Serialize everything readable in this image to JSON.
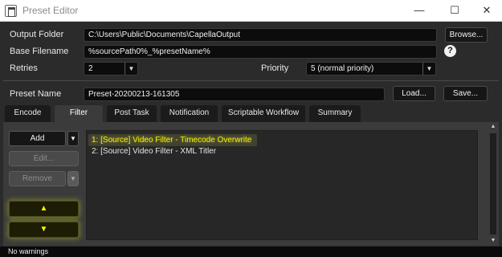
{
  "window": {
    "title": "Preset Editor",
    "minimize_glyph": "—",
    "maximize_glyph": "☐",
    "close_glyph": "✕"
  },
  "form": {
    "output_folder_label": "Output Folder",
    "output_folder_value": "C:\\Users\\Public\\Documents\\CapellaOutput",
    "browse_label": "Browse...",
    "base_filename_label": "Base Filename",
    "base_filename_value": "%sourcePath0%_%presetName%",
    "help_glyph": "?",
    "retries_label": "Retries",
    "retries_value": "2",
    "priority_label": "Priority",
    "priority_value": "5 (normal priority)",
    "preset_name_label": "Preset Name",
    "preset_name_value": "Preset-20200213-161305",
    "load_label": "Load...",
    "save_label": "Save..."
  },
  "tabs": [
    {
      "label": "Encode"
    },
    {
      "label": "Filter",
      "active": true
    },
    {
      "label": "Post Task"
    },
    {
      "label": "Notification"
    },
    {
      "label": "Scriptable Workflow"
    },
    {
      "label": "Summary"
    }
  ],
  "filter_panel": {
    "add_label": "Add",
    "edit_label": "Edit...",
    "remove_label": "Remove",
    "dropdown_glyph": "▼",
    "move_up_glyph": "▲",
    "move_down_glyph": "▼",
    "items": [
      {
        "text": "1: [Source] Video Filter - Timecode Overwrite",
        "selected": true
      },
      {
        "text": "2: [Source] Video Filter - XML Titler",
        "selected": false
      }
    ]
  },
  "scrollbar": {
    "up_glyph": "▲",
    "down_glyph": "▼"
  },
  "status": {
    "text": "No warnings"
  },
  "colors": {
    "accent": "#f3f300",
    "background": "#2b2b2b",
    "panel": "#3b3b3b"
  }
}
